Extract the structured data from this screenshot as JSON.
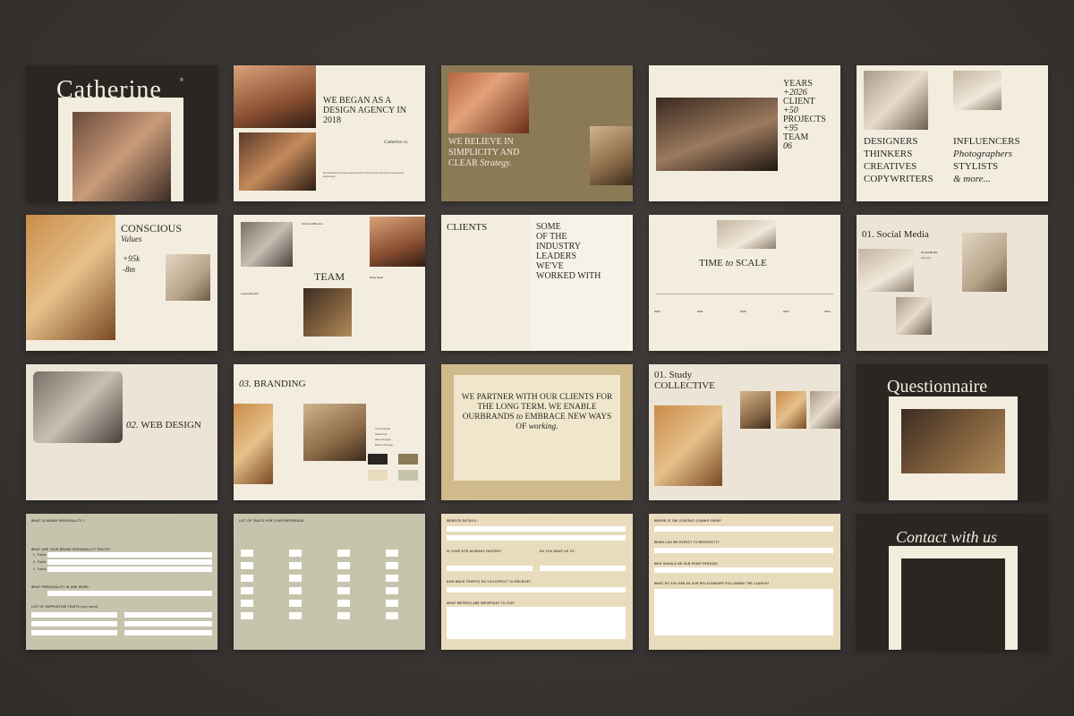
{
  "slides": {
    "s1": {
      "title": "Catherine",
      "reg": "®"
    },
    "s2": {
      "title": "We began as a design agency in 2018",
      "sign": "Catherine co."
    },
    "s3": {
      "title_a": "We believe in simplicity and clear",
      "title_b": "Strategy."
    },
    "s4": {
      "l1": "Years",
      "l2": "+2026",
      "l3": "Client",
      "l4": "+50",
      "l5": "Projects",
      "l6": "+95",
      "l7": "Team",
      "l8": "06"
    },
    "s5": {
      "col1": [
        "Designers",
        "Thinkers",
        "Creatives",
        "Copywriters"
      ],
      "col2": [
        "Influencers",
        "Photographers",
        "Stylists",
        "& more..."
      ]
    },
    "s6": {
      "title": "Conscious",
      "sub": "Values",
      "n1": "+95k",
      "n2": "-8m"
    },
    "s7": {
      "title": "Team",
      "name1": "Victoria Winston",
      "name2": "Kelly Sean",
      "name3": "Lesley Brown"
    },
    "s8": {
      "clients": "Clients",
      "t1": "Some",
      "t2": "of the",
      "t3": "industry",
      "t4": "leaders",
      "t5": "we've",
      "t6": "worked with"
    },
    "s9": {
      "a": "Time",
      "b": "to",
      "c": "Scale",
      "years": [
        "2020",
        "2021",
        "2022",
        "2023",
        "2024"
      ]
    },
    "s10": {
      "num": "01.",
      "title": "Social Media",
      "b1": "Social Media",
      "b2": "Example"
    },
    "s11": {
      "num": "02.",
      "title": "Web Design"
    },
    "s12": {
      "num": "03.",
      "title": "Branding",
      "bullets": [
        "Social Media",
        "Marketing",
        "Web Designs",
        "Brand Strategy"
      ]
    },
    "s13": {
      "a": "We partner with our clients for the long term. We enable ourbrands",
      "b": "to",
      "c": "embrace new ways of",
      "d": "working."
    },
    "s14": {
      "num": "01.",
      "title": "Study",
      "title2": "Collective"
    },
    "s15": {
      "title": "Questionnaire"
    },
    "s16": {
      "q1": "WHAT IS BRAND PERSONALITY ?",
      "q2": "WHAT ARE YOUR BRAND PERSONALITY TRAITS?",
      "q3": "WHAT PERSONALITY IN ONE WORD",
      "q4": "LIST OF SUPPORTING TRAITS (one word)",
      "n1": "1. Traits",
      "n2": "2. Traits",
      "n3": "3. Traits"
    },
    "s17": {
      "q": "LIST OF TRAITS FOR YOUR REFERENCE"
    },
    "s18": {
      "q1": "WEBSITE DETAILS :",
      "q2": "IS YOUR SITE ALREADY HOSTED?",
      "q3": "DO YOU WANT US TO:",
      "q4": "HOW MUCH TRAFFIC DO YOU EXPECT TO RECEIVE?",
      "q5": "WHAT METRICS ARE IMPORTANT TO YOU?"
    },
    "s19": {
      "q1": "WHERE IS THE CONTENT COMING FROM?",
      "q2": "WHEN CAN WE EXPECT TO RECEIVE IT?",
      "q3": "WHO SHOULD BE OUR POINT PERSON?",
      "q4": "WHAT DO YOU SEE AS OUR RELATIONSHIP FOLLOWING THE LAUNCH?"
    },
    "s20": {
      "title": "Contact with us"
    }
  }
}
